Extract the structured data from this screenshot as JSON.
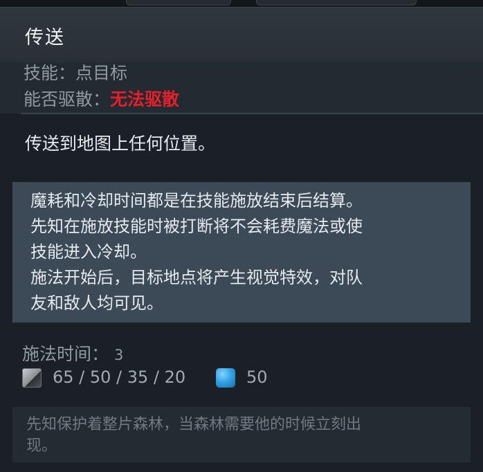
{
  "ability": {
    "title": "传送",
    "skill_label": "技能：",
    "skill_value": "点目标",
    "dispel_label": "能否驱散：",
    "dispel_value": "无法驱散",
    "description": "传送到地图上任何位置。"
  },
  "notes": [
    "魔耗和冷却时间都是在技能施放结束后结算。",
    "先知在施放技能时被打断将不会耗费魔法或使",
    "技能进入冷却。",
    "施法开始后，目标地点将产生视觉特效，对队",
    "友和敌人均可见。"
  ],
  "cast_time": {
    "label": "施法时间：",
    "value": "3"
  },
  "costs": {
    "cooldown": "65 / 50 / 35 / 20",
    "mana": "50",
    "cooldown_icon": "cooldown-icon",
    "mana_icon": "mana-icon"
  },
  "lore": [
    "先知保护着整片森林，当森林需要他的时候立刻出",
    "现。"
  ],
  "colors": {
    "dispel": "#e5202a",
    "notes_bg": "#3b4a56",
    "panel_bg": "#1b2026"
  }
}
